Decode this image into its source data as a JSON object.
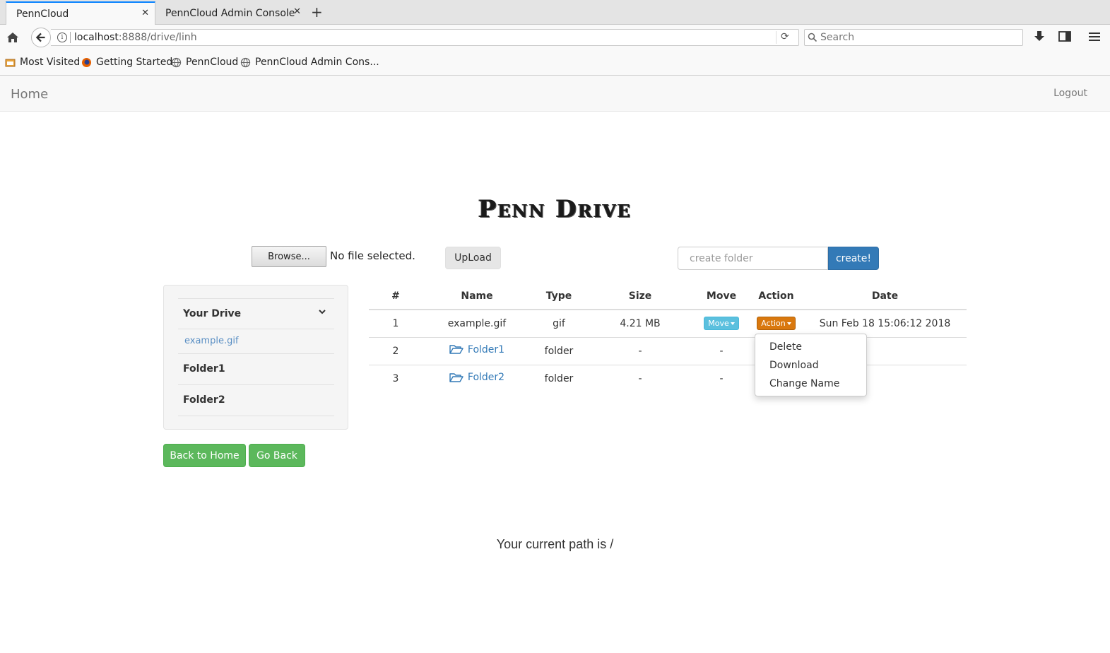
{
  "browser": {
    "tabs": [
      {
        "title": "PennCloud"
      },
      {
        "title": "PennCloud Admin Console"
      }
    ],
    "url_host": "localhost",
    "url_path": ":8888/drive/linh",
    "search_placeholder": "Search",
    "bookmarks": [
      {
        "label": "Most Visited"
      },
      {
        "label": "Getting Started"
      },
      {
        "label": "PennCloud"
      },
      {
        "label": "PennCloud Admin Cons..."
      }
    ]
  },
  "nav": {
    "home": "Home",
    "logout": "Logout"
  },
  "logo": "Penn Drive",
  "upload": {
    "browse": "Browse...",
    "no_file": "No file selected.",
    "upload": "UpLoad"
  },
  "create_folder": {
    "placeholder": "create folder",
    "button": "create!"
  },
  "sidebar": {
    "title": "Your Drive",
    "items": [
      {
        "label": "example.gif"
      },
      {
        "label": "Folder1"
      },
      {
        "label": "Folder2"
      }
    ]
  },
  "table": {
    "headers": [
      "#",
      "Name",
      "Type",
      "Size",
      "Move",
      "Action",
      "Date"
    ],
    "rows": [
      {
        "num": "1",
        "name": "example.gif",
        "type": "gif",
        "size": "4.21 MB",
        "move": "Move",
        "action": "Action",
        "date": "Sun Feb 18 15:06:12 2018"
      },
      {
        "num": "2",
        "name": "Folder1",
        "type": "folder",
        "size": "-",
        "move": "-",
        "action": "",
        "date": ""
      },
      {
        "num": "3",
        "name": "Folder2",
        "type": "folder",
        "size": "-",
        "move": "-",
        "action": "",
        "date": ""
      }
    ]
  },
  "action_menu": [
    "Delete",
    "Download",
    "Change Name"
  ],
  "buttons": {
    "back_home": "Back to Home",
    "go_back": "Go Back"
  },
  "path": "Your current path is /",
  "colors": {
    "primary": "#337ab7",
    "success": "#5cb85c",
    "info": "#5bc0de",
    "action": "#d9780e"
  }
}
